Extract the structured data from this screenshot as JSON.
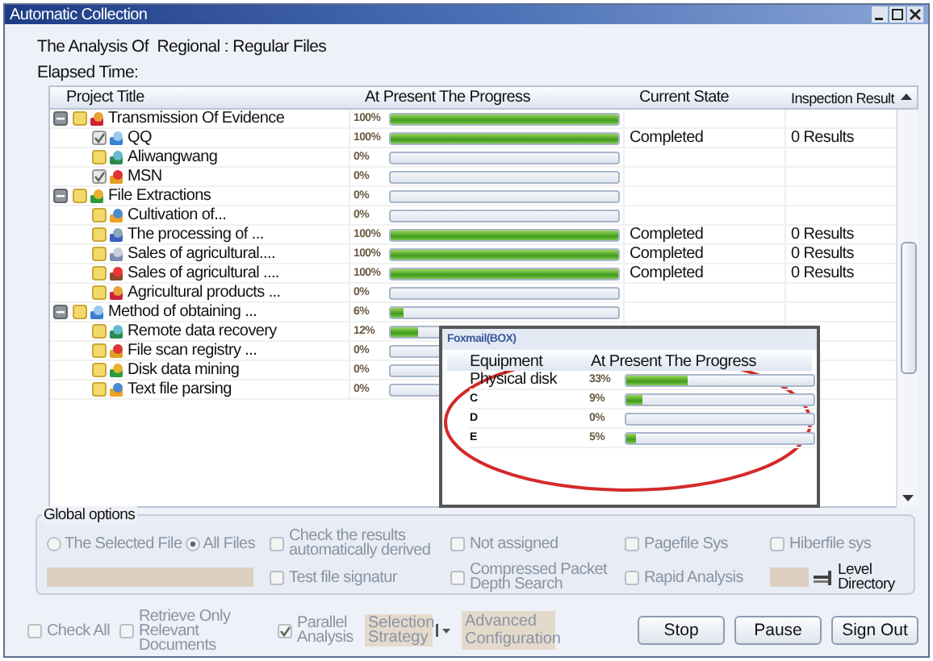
{
  "window": {
    "title": "Automatic Collection"
  },
  "header": {
    "analysis": "The Analysis Of  Regional : Regular Files",
    "elapsed": "Elapsed Time:"
  },
  "table": {
    "columns": [
      "Project Title",
      "At Present The Progress",
      "Current State",
      "Inspection Result"
    ],
    "rows": [
      {
        "name": "Transmission Of Evidence",
        "expanded": true,
        "checked": false,
        "progress": "100%",
        "level": 1,
        "children": [
          {
            "name": "QQ",
            "checked": true,
            "progress": "100%",
            "level": 1,
            "state": "Completed",
            "result": "0 Results"
          },
          {
            "name": "Aliwangwang",
            "checked": false,
            "progress": "0%",
            "level": 0
          },
          {
            "name": "MSN",
            "checked": true,
            "progress": "0%",
            "level": 0
          }
        ]
      },
      {
        "name": "File Extractions",
        "expanded": true,
        "checked": false,
        "progress": "0%",
        "level": 0,
        "children": [
          {
            "name": "Cultivation of...",
            "checked": false,
            "progress": "0%",
            "level": 0
          },
          {
            "name": "The processing of ...",
            "checked": false,
            "progress": "100%",
            "level": 1,
            "state": "Completed",
            "result": "0 Results"
          },
          {
            "name": "Sales of agricultural....",
            "checked": false,
            "progress": "100%",
            "level": 1,
            "state": "Completed",
            "result": "0 Results"
          },
          {
            "name": "Sales of agricultural ....",
            "checked": false,
            "progress": "100%",
            "level": 1,
            "state": "Completed",
            "result": "0 Results"
          },
          {
            "name": "Agricultural products ...",
            "checked": false,
            "progress": "0%",
            "level": 0
          }
        ]
      },
      {
        "name": "Method of obtaining ...",
        "expanded": true,
        "checked": false,
        "progress": "6%",
        "level": 0.06,
        "children": [
          {
            "name": "Remote data recovery",
            "checked": false,
            "progress": "12%",
            "level": 0.12
          },
          {
            "name": "File scan registry ...",
            "checked": false,
            "progress": "0%",
            "level": 0
          },
          {
            "name": "Disk data mining",
            "checked": false,
            "progress": "0%",
            "level": 0
          },
          {
            "name": "Text file parsing",
            "checked": false,
            "progress": "0%",
            "level": 0
          }
        ]
      }
    ]
  },
  "popup": {
    "title": "Foxmail(BOX)",
    "columns": [
      "Equipment",
      "At Present The Progress"
    ],
    "rows": [
      {
        "name": "Physical disk",
        "progress": "33%",
        "level": 0.33
      },
      {
        "name": "C",
        "progress": "9%",
        "level": 0.09
      },
      {
        "name": "D",
        "progress": "0%",
        "level": 0
      },
      {
        "name": "E",
        "progress": "5%",
        "level": 0.05
      }
    ]
  },
  "global_options": {
    "title": "Global options",
    "scope": [
      {
        "label": "The Selected File",
        "selected": false
      },
      {
        "label": "All Files",
        "selected": true
      }
    ],
    "checks": [
      {
        "label": "Check the results automatically derived",
        "checked": false
      },
      {
        "label": "Test file signatur",
        "checked": false
      },
      {
        "label": "Not assigned",
        "checked": false
      },
      {
        "label": "Compressed Packet Depth Search",
        "checked": false
      },
      {
        "label": "Pagefile Sys",
        "checked": false
      },
      {
        "label": "Rapid Analysis",
        "checked": false
      },
      {
        "label": "Hiberfile sys",
        "checked": false
      }
    ],
    "level_label": "Level Directory"
  },
  "bottom": {
    "checks": [
      {
        "label": "Check All",
        "checked": false
      },
      {
        "label": "Retrieve Only Relevant Documents",
        "checked": false
      },
      {
        "label": "Parallel Analysis",
        "checked": true
      }
    ],
    "strategy": "Selection Strategy",
    "advanced": "Advanced Configuration",
    "buttons": [
      "Stop",
      "Pause",
      "Sign Out"
    ]
  }
}
